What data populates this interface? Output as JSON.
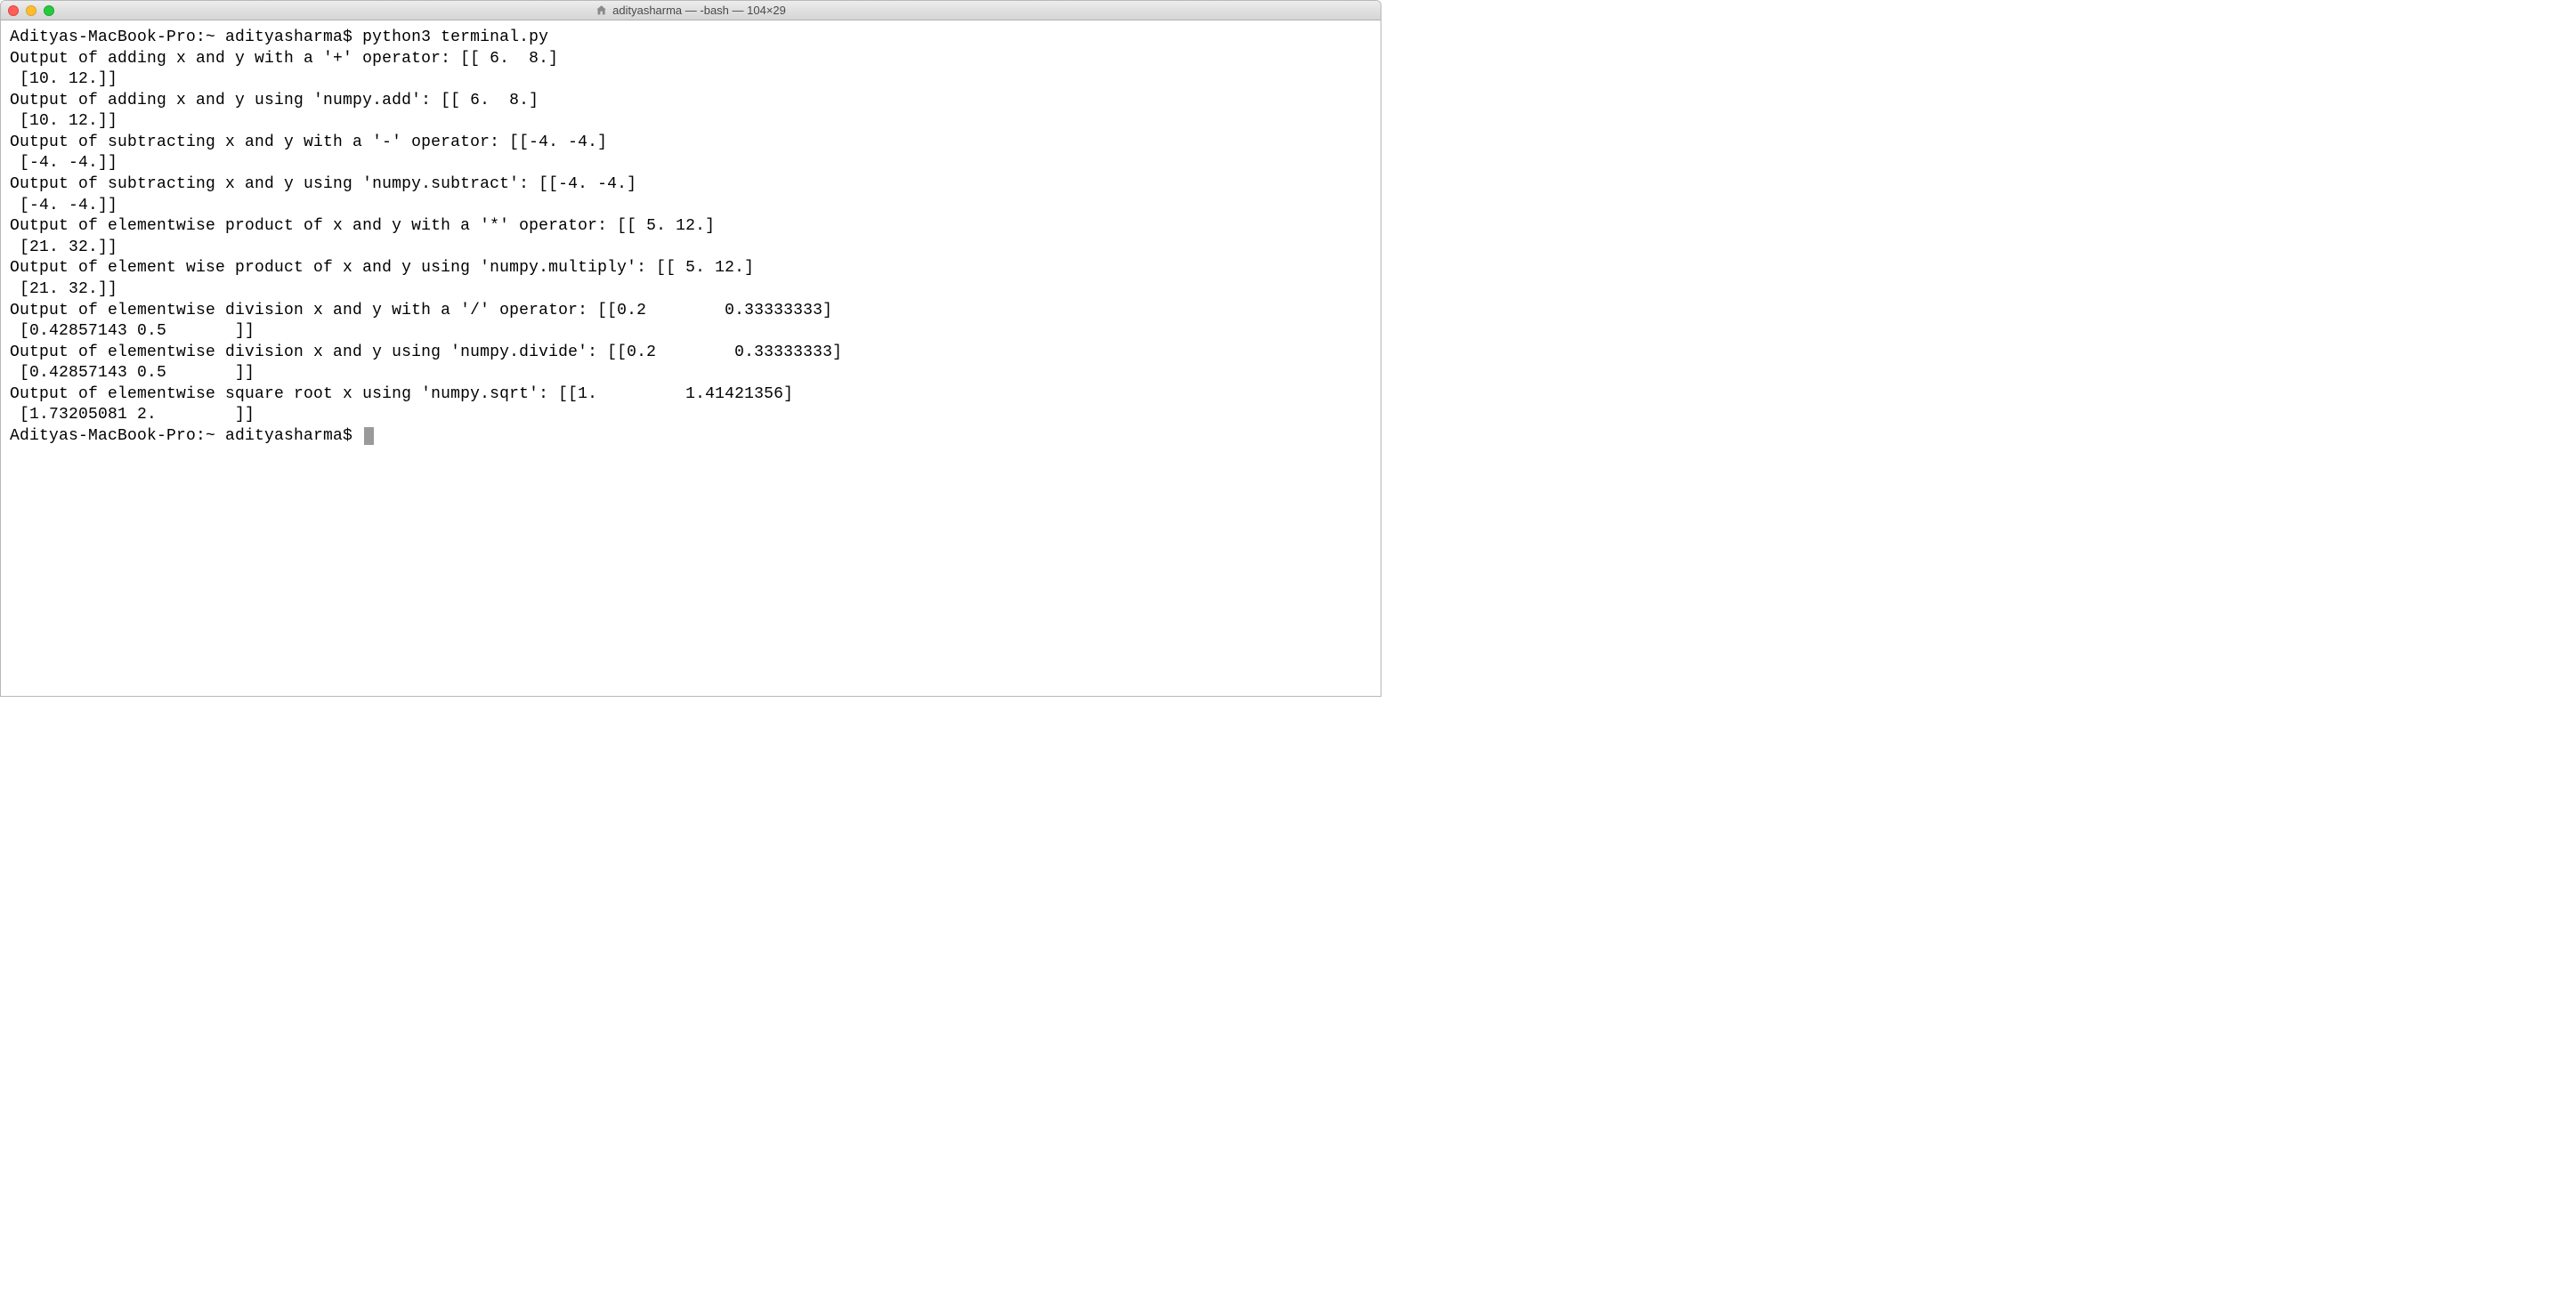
{
  "window": {
    "title": "adityasharma — -bash — 104×29"
  },
  "terminal": {
    "prompt_line": "Adityas-MacBook-Pro:~ adityasharma$ python3 terminal.py",
    "output_lines": [
      "Output of adding x and y with a '+' operator: [[ 6.  8.]",
      " [10. 12.]]",
      "Output of adding x and y using 'numpy.add': [[ 6.  8.]",
      " [10. 12.]]",
      "Output of subtracting x and y with a '-' operator: [[-4. -4.]",
      " [-4. -4.]]",
      "Output of subtracting x and y using 'numpy.subtract': [[-4. -4.]",
      " [-4. -4.]]",
      "Output of elementwise product of x and y with a '*' operator: [[ 5. 12.]",
      " [21. 32.]]",
      "Output of element wise product of x and y using 'numpy.multiply': [[ 5. 12.]",
      " [21. 32.]]",
      "Output of elementwise division x and y with a '/' operator: [[0.2        0.33333333]",
      " [0.42857143 0.5       ]]",
      "Output of elementwise division x and y using 'numpy.divide': [[0.2        0.33333333]",
      " [0.42857143 0.5       ]]",
      "Output of elementwise square root x using 'numpy.sqrt': [[1.         1.41421356]",
      " [1.73205081 2.        ]]"
    ],
    "final_prompt": "Adityas-MacBook-Pro:~ adityasharma$ "
  }
}
